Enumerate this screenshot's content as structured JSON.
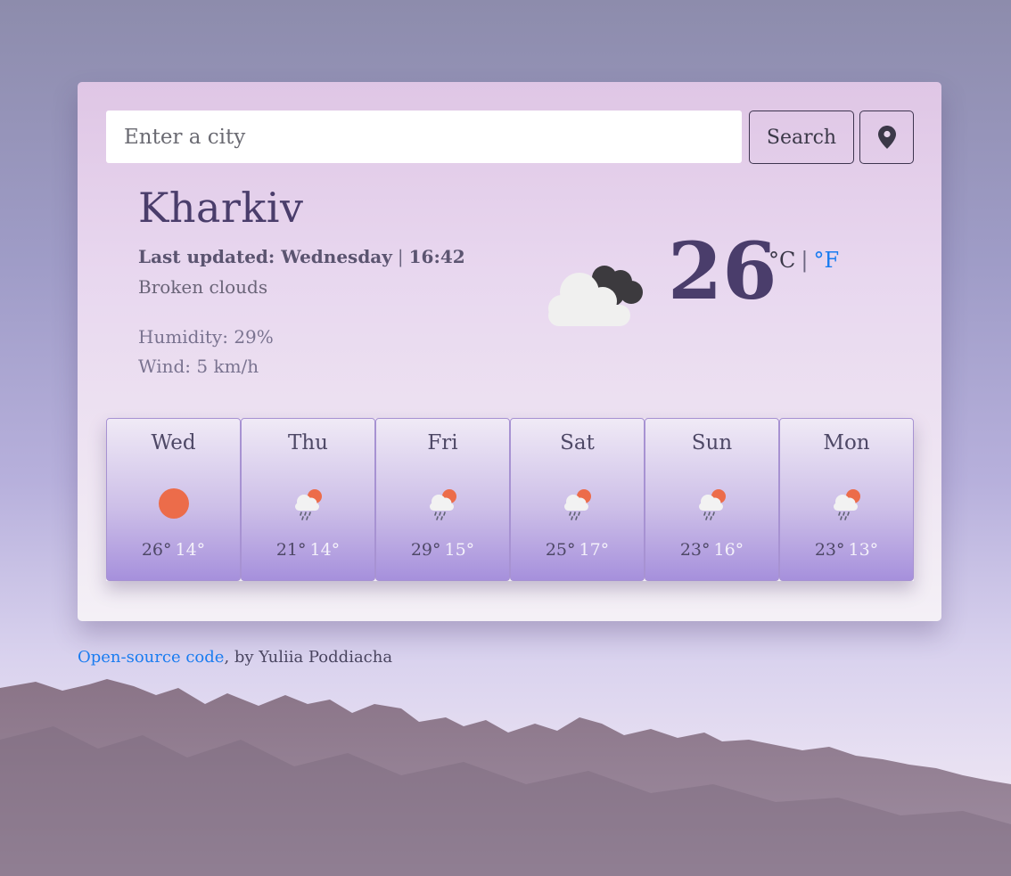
{
  "search": {
    "placeholder": "Enter a city",
    "button_label": "Search",
    "location_icon": "map-pin-icon"
  },
  "current": {
    "city": "Kharkiv",
    "last_updated_label": "Last updated:",
    "day": "Wednesday",
    "separator": "|",
    "time": "16:42",
    "description": "Broken clouds",
    "humidity": "Humidity: 29%",
    "wind": "Wind: 5 km/h",
    "temperature": "26",
    "unit_c": "°C",
    "unit_sep": "|",
    "unit_f": "°F",
    "icon": "broken-clouds-icon"
  },
  "forecast": [
    {
      "day": "Wed",
      "max": "26°",
      "min": "14°",
      "icon": "sun-icon"
    },
    {
      "day": "Thu",
      "max": "21°",
      "min": "14°",
      "icon": "rain-sun-icon"
    },
    {
      "day": "Fri",
      "max": "29°",
      "min": "15°",
      "icon": "rain-sun-icon"
    },
    {
      "day": "Sat",
      "max": "25°",
      "min": "17°",
      "icon": "rain-sun-icon"
    },
    {
      "day": "Sun",
      "max": "23°",
      "min": "16°",
      "icon": "rain-sun-icon"
    },
    {
      "day": "Mon",
      "max": "23°",
      "min": "13°",
      "icon": "rain-sun-icon"
    }
  ],
  "footer": {
    "link_text": "Open-source code",
    "byline": ", by Yuliia Poddiacha"
  },
  "colors": {
    "accent_link": "#1a7cf0",
    "city_text": "#4a3d6b",
    "sun": "#ec6c4a"
  }
}
